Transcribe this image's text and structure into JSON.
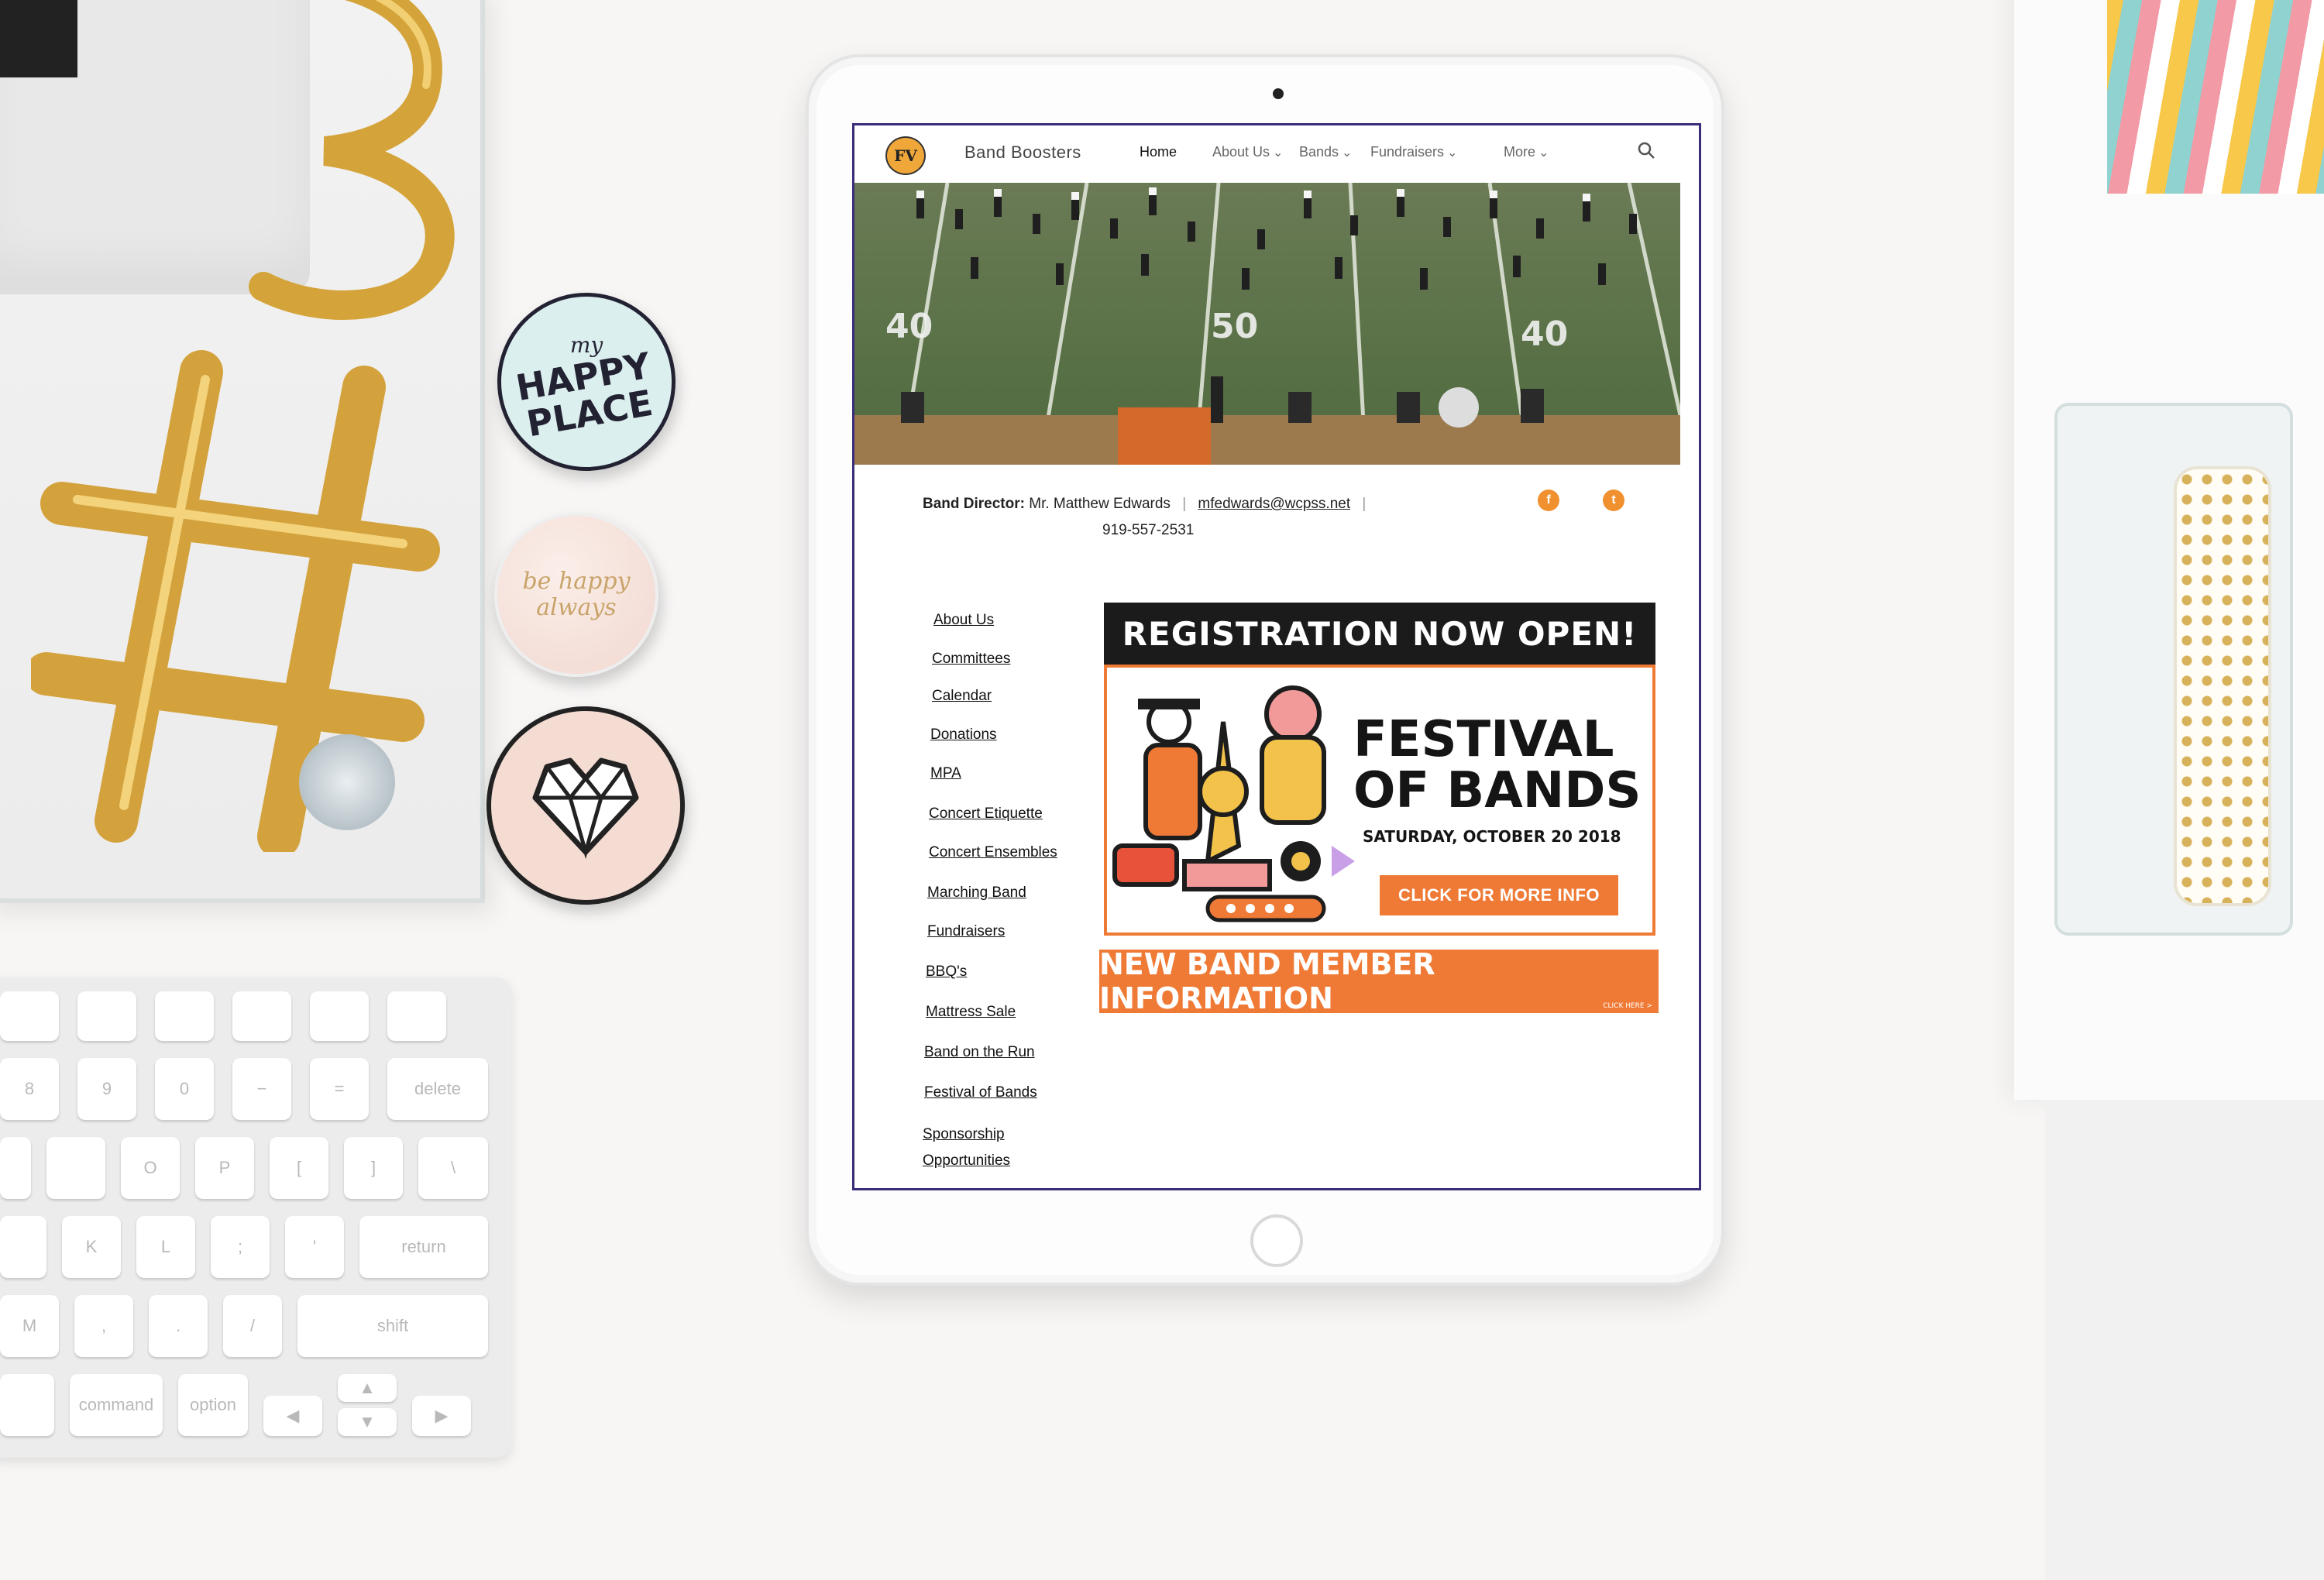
{
  "desk": {
    "magnet_top_small": "my",
    "magnet_top_big": "HAPPY PLACE",
    "magnet_mid": "be happy always",
    "keyboard_keys": [
      "8",
      "9",
      "0",
      "−",
      "=",
      "delete",
      "O",
      "P",
      "[",
      "]",
      "\\",
      "K",
      "L",
      ";",
      "'",
      "return",
      "M",
      ",",
      ".",
      "/",
      "shift",
      "⌘",
      "command",
      "option"
    ]
  },
  "nav": {
    "logo_text": "FV",
    "site_title": "Band Boosters",
    "items": [
      {
        "label": "Home"
      },
      {
        "label": "About Us"
      },
      {
        "label": "Bands"
      },
      {
        "label": "Fundraisers"
      },
      {
        "label": "More"
      }
    ]
  },
  "director": {
    "label": "Band Director:",
    "name": "Mr. Matthew Edwards",
    "email": "mfedwards@wcpss.net",
    "phone": "919-557-2531"
  },
  "social": {
    "facebook": "f",
    "twitter": "t"
  },
  "sidebar": {
    "links": [
      "About Us",
      "Committees",
      "Calendar",
      "Donations",
      "MPA",
      "Concert Etiquette",
      "Concert Ensembles",
      "Marching Band",
      "Fundraisers",
      "BBQ's",
      "Mattress Sale",
      "Band on the Run",
      "Festival of Bands",
      "Sponsorship",
      "Opportunities"
    ]
  },
  "registration": {
    "header": "REGISTRATION NOW OPEN!",
    "title_line1": "FESTIVAL",
    "title_line2": "OF BANDS",
    "date": "SATURDAY, OCTOBER 20 2018",
    "button": "CLICK FOR MORE INFO"
  },
  "new_member": {
    "label": "NEW BAND MEMBER INFORMATION",
    "click": "CLICK HERE >"
  },
  "colors": {
    "accent": "#ef7a36",
    "nav_border": "#3a2d7a"
  }
}
